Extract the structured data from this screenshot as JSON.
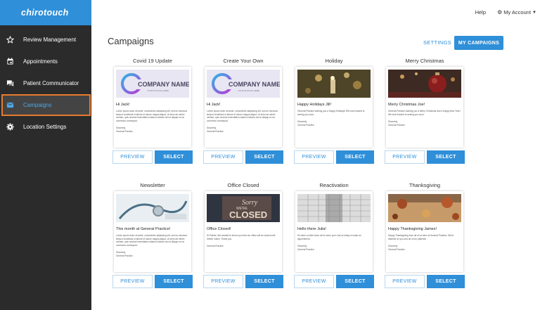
{
  "sidebar": {
    "logo": "chirotouch",
    "items": [
      {
        "label": "Review Management",
        "icon": "star-icon"
      },
      {
        "label": "Appointments",
        "icon": "calendar-icon"
      },
      {
        "label": "Patient Communicator",
        "icon": "chat-icon"
      },
      {
        "label": "Campaigns",
        "icon": "mail-icon",
        "active": true
      },
      {
        "label": "Location Settings",
        "icon": "gear-icon"
      }
    ]
  },
  "topbar": {
    "help": "Help",
    "account": "My Account"
  },
  "page": {
    "title": "Campaigns",
    "settings": "SETTINGS",
    "my_campaigns": "MY CAMPAIGNS"
  },
  "buttons": {
    "preview": "PREVIEW",
    "select": "SELECT"
  },
  "colors": {
    "accent": "#2f8fd8",
    "sidebar": "#2b2b2b",
    "active_outline": "#e87a2e"
  },
  "cards": [
    {
      "title": "Covid 19 Update",
      "image": "company-name-logo",
      "greeting": "Hi Jack!",
      "body": "Lorem ipsum dolor sit amet, consectetur adipiscing elit, sed do eiusmod tempor incididunt ut labore et dolore magna aliqua. Ut enim ad minim veniam, quis nostrud exercitation ullamco laboris nisi ut aliquip ex ea commodo consequat.",
      "sign1": "Sincerely,",
      "sign2": "General Practice"
    },
    {
      "title": "Create Your Own",
      "image": "company-name-logo",
      "greeting": "Hi Jack!",
      "body": "Lorem ipsum dolor sit amet, consectetur adipiscing elit, sed do eiusmod tempor incididunt ut labore et dolore magna aliqua. Ut enim ad minim veniam, quis nostrud exercitation ullamco laboris nisi ut aliquip ex ea commodo consequat.",
      "sign1": "Sincerely,",
      "sign2": "General Practice"
    },
    {
      "title": "Holiday",
      "image": "holiday-lights",
      "greeting": "Happy Holidays Jill!",
      "body": "General Practice wishing you a Happy Holidays! We look forward to seeing you soon.",
      "sign1": "Sincerely,",
      "sign2": "General Practice"
    },
    {
      "title": "Merry Christmas",
      "image": "christmas-ornament",
      "greeting": "Merry Christmas Joe!",
      "body": "General Practice wishing you a Merry Christmas and a Happy New Year! We look forward to seeing you soon.",
      "sign1": "Sincerely,",
      "sign2": "General Practice"
    },
    {
      "title": "Newsletter",
      "image": "stethoscope",
      "greeting": "This month at General Practice!",
      "body": "Lorem ipsum dolor sit amet, consectetur adipiscing elit, sed do eiusmod tempor incididunt ut labore et dolore magna aliqua. Ut enim ad minim veniam, quis nostrud exercitation ullamco laboris nisi ut aliquip ex ea commodo consequat.",
      "sign1": "Sincerely,",
      "sign2": "General Practice"
    },
    {
      "title": "Office Closed",
      "image": "closed-sign",
      "greeting": "Office Closed!",
      "body": "Hi Patrick, We wanted to inform you that our office will be closed until further notice. Thank you,",
      "sign1": "",
      "sign2": "General Practice"
    },
    {
      "title": "Reactivation",
      "image": "calendar-page",
      "greeting": "Hello there Julia!",
      "body": "It's been a while since we've seen you! Call us today to make an appointment.",
      "sign1": "Sincerely,",
      "sign2": "General Practice"
    },
    {
      "title": "Thanksgiving",
      "image": "autumn-table",
      "greeting": "Happy Thanksgiving James!",
      "body": "Happy Thanksgiving from all of us here at General Practice. We're thankful for you and all of our patients!",
      "sign1": "Sincerely,",
      "sign2": "General Practice"
    }
  ]
}
